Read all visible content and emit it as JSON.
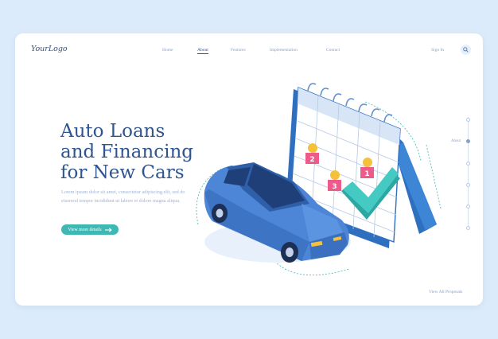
{
  "header": {
    "logo": "YourLogo",
    "nav": [
      {
        "label": "Home",
        "active": false
      },
      {
        "label": "About",
        "active": true
      },
      {
        "label": "Features",
        "active": false
      },
      {
        "label": "Implementation",
        "active": false
      },
      {
        "label": "Contact",
        "active": false
      }
    ],
    "sign_in": "Sign In",
    "search_icon": "search-icon"
  },
  "hero": {
    "title": "Auto Loans\nand Financing\nfor New Cars",
    "body": "Lorem ipsum dolor sit amet, consectetur adipiscing elit, sed do eiusmod tempor incididunt ut labore et dolore magna aliqua.",
    "cta_label": "View more details",
    "cta_icon": "arrow-right-icon"
  },
  "illustration": {
    "calendar_days": [
      "2",
      "3",
      "1"
    ],
    "check_icon": "checkmark-icon",
    "car_icon": "car-icon"
  },
  "side_nav": {
    "label": "About",
    "active_index": 1,
    "dot_count": 6
  },
  "footer": {
    "link": "View All Proposals"
  },
  "colors": {
    "page_bg": "#dcebfb",
    "primary": "#2f558f",
    "accent": "#3fb8b4",
    "muted": "#8aa0c4"
  }
}
